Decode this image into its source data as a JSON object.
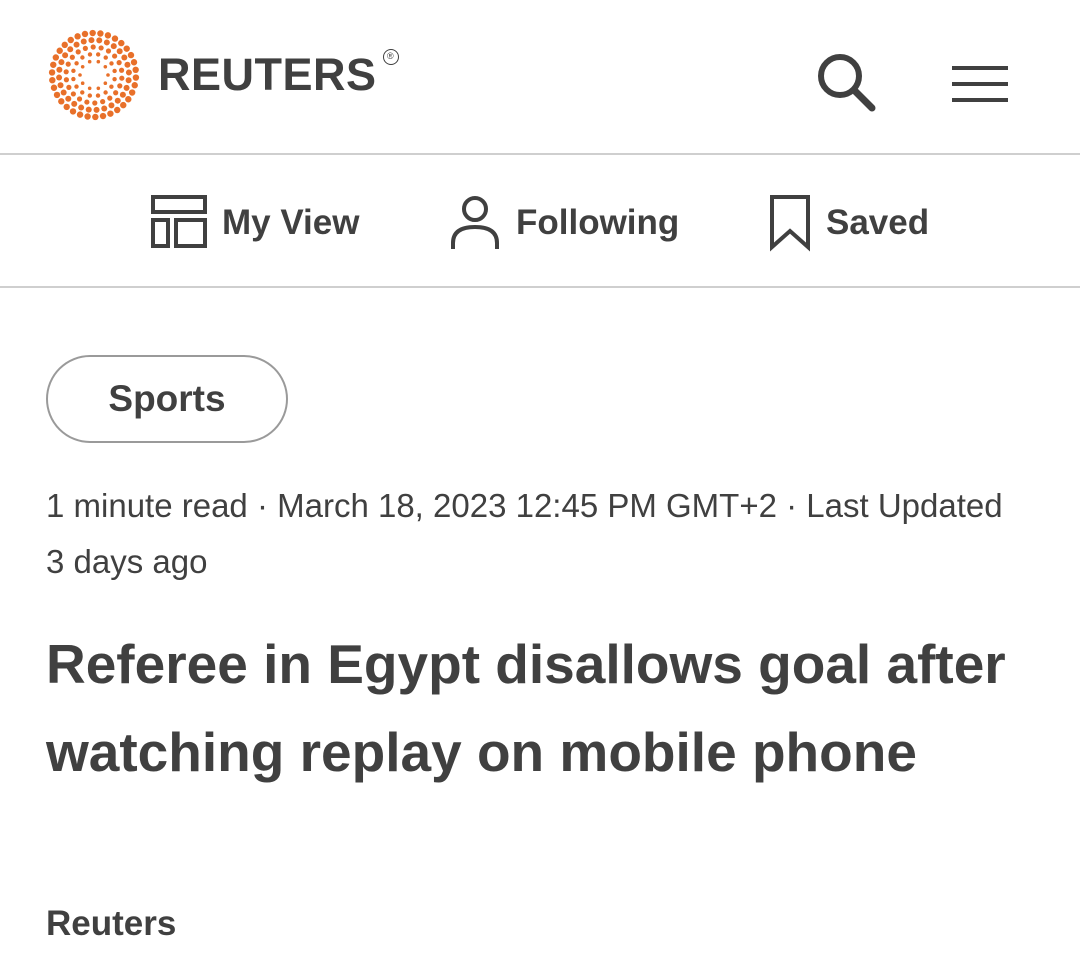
{
  "header": {
    "logo_text": "REUTERS",
    "registered_mark": "®",
    "brand_color": "#E8702A",
    "search_icon": "search-icon",
    "menu_icon": "hamburger-menu-icon"
  },
  "subnav": {
    "items": [
      {
        "label": "My View",
        "icon": "layout-icon"
      },
      {
        "label": "Following",
        "icon": "person-icon"
      },
      {
        "label": "Saved",
        "icon": "bookmark-icon"
      }
    ]
  },
  "article": {
    "section": "Sports",
    "meta": "1 minute read · March 18, 2023 12:45 PM GMT+2 · Last Updated 3 days ago",
    "headline": "Referee in Egypt disallows goal after watching replay on mobile phone",
    "byline": "Reuters"
  }
}
